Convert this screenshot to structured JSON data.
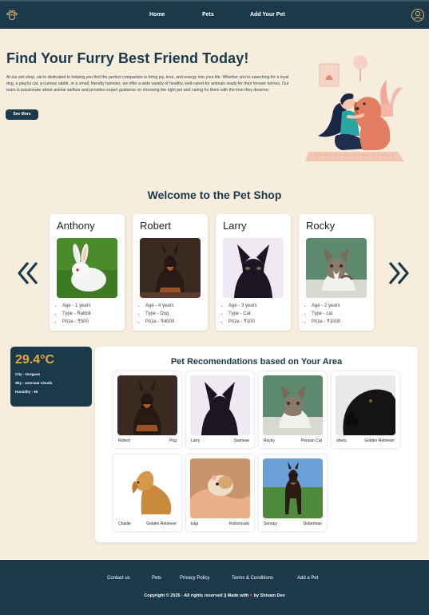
{
  "nav": {
    "links": [
      "Home",
      "Pets",
      "Add Your Pet"
    ],
    "logo_icon": "paw-icon",
    "user_icon": "user-circle-icon"
  },
  "hero": {
    "title": "Find Your Furry Best Friend Today!",
    "text": "At our pet shop, we're dedicated to helping you find the perfect companion to bring joy, love, and energy into your life. Whether you're searching for a loyal dog, a playful cat, a curious rabbit, or a small, friendly hamster, we offer a wide variety of healthy, well-cared-for animals ready for their forever homes. Our team is passionate about animal welfare and provides expert guidance on choosing the right pet and caring for them with the love they deserve.",
    "button": "See More"
  },
  "shop": {
    "title": "Welcome to the Pet Shop",
    "cards": [
      {
        "name": "Anthony",
        "age": "Age - 1 years",
        "type": "Type - Rabbit",
        "price": "Prize - ₹500"
      },
      {
        "name": "Robert",
        "age": "Age - 4 years",
        "type": "Type - Dog",
        "price": "Prize - ₹4000"
      },
      {
        "name": "Larry",
        "age": "Age - 3 years",
        "type": "Type - Cat",
        "price": "Prize - ₹100"
      },
      {
        "name": "Rocky",
        "age": "Age - 2 years",
        "type": "Type - cat",
        "price": "Prize - ₹1000"
      }
    ]
  },
  "weather": {
    "temp": "29.4°C",
    "city": "City - Gurgaon",
    "sky": "Sky - overcast clouds",
    "humidity": "Humidity - 65"
  },
  "recommendations": {
    "title": "Pet Recomendations based on Your Area",
    "items": [
      {
        "name": "Robert",
        "breed": "Pug"
      },
      {
        "name": "Larry",
        "breed": "Siamese"
      },
      {
        "name": "Rocky",
        "breed": "Persian Cat"
      },
      {
        "name": "sheru",
        "breed": "Golden Retriever"
      },
      {
        "name": "Charlie",
        "breed": "Golden Retriever"
      },
      {
        "name": "luigi",
        "breed": "Roborovski"
      },
      {
        "name": "Snoopy",
        "breed": "Doberman"
      }
    ]
  },
  "footer": {
    "links": [
      "Contact us",
      "Pets",
      "Privacy Policy",
      "Terms & Conditions",
      "Add a Pet"
    ],
    "copy_left": "Copyright © 2025 - All rights reserved || Made with",
    "copy_right": "by Shivam Dev",
    "heart_icon": "heart-icon"
  },
  "colors": {
    "navy": "#1a3a4c",
    "cream": "#f6eddd",
    "accent": "#e3a83b"
  }
}
